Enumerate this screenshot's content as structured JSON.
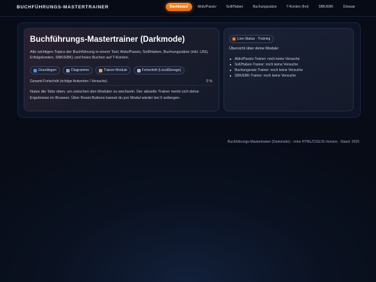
{
  "header": {
    "brand": "BUCHFÜHRUNGS-MASTERTRAINER",
    "nav": [
      {
        "label": "Dashboard",
        "active": true
      },
      {
        "label": "Aktiv/Passiv",
        "active": false
      },
      {
        "label": "Soll/Haben",
        "active": false
      },
      {
        "label": "Buchungssätze",
        "active": false
      },
      {
        "label": "T-Konten (frei)",
        "active": false
      },
      {
        "label": "SBK/EBK",
        "active": false
      },
      {
        "label": "Glossar",
        "active": false
      }
    ]
  },
  "hero": {
    "title": "Buchführungs-Mastertrainer (Darkmode)",
    "intro": "Alle wichtigen Topics der Buchführung in einem Tool: Aktiv/Passiv, Soll/Haben, Buchungssätze (inkl. USt), Erfolgskonten, SBK/EBK) und freies Buchen auf T-Konten.",
    "chips": [
      {
        "icon": "book-icon",
        "label": "Grundlagen",
        "color": "#4a8fe0"
      },
      {
        "icon": "chart-icon",
        "label": "Diagramme",
        "color": "#8fa4c8"
      },
      {
        "icon": "module-icon",
        "label": "Trainer-Module",
        "color": "#e0a060"
      },
      {
        "icon": "save-icon",
        "label": "Fortschritt (LocalStorage)",
        "color": "#b0b8cc"
      }
    ],
    "progress_label": "Gesamt-Fortschritt (richtige Antworten / Versuche)",
    "progress_value": "0 %",
    "progress_fraction": 0,
    "hint": "Nutze die Tabs oben, um zwischen den Modulen zu wechseln. Der aktuelle Trainer merkt sich deine Ergebnisse im Browser. Über Reset-Buttons kannst du pro Modul wieder bei 0 anfangen."
  },
  "status": {
    "badge": "Live-Status · Training",
    "overview_title": "Übersicht über deine Module:",
    "modules": [
      "Aktiv/Passiv-Trainer: noch keine Versuche",
      "Soll/Haben-Trainer: noch keine Versuche",
      "Buchungssatz-Trainer: noch keine Versuche",
      "SBK/EBK-Trainer: noch keine Versuche"
    ]
  },
  "footer": {
    "text": "Buchführungs-Mastertrainer (Darkmode) · reine HTML/CSS/JS-Version · Stand: 2025"
  },
  "colors": {
    "accent": "#f08a2a",
    "background": "#0a1120"
  }
}
